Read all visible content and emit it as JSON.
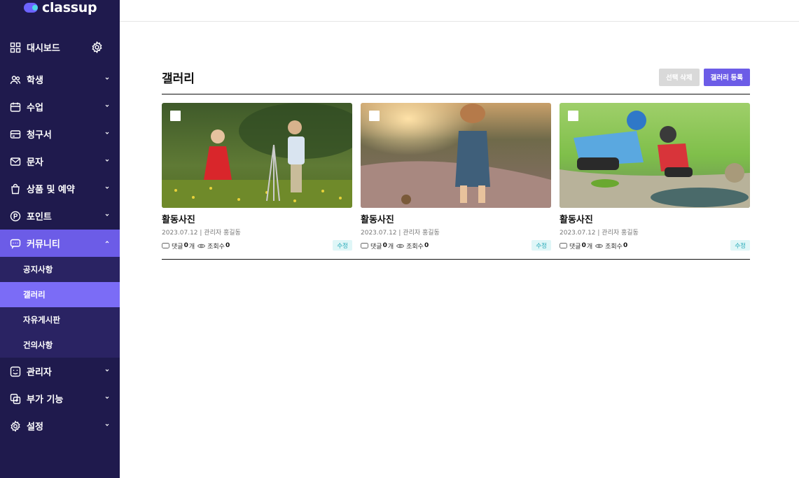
{
  "brand": {
    "name": "classup"
  },
  "sidebar": {
    "items": [
      {
        "label": "대시보드",
        "icon": "grid-icon"
      },
      {
        "label": "학생",
        "icon": "users-icon"
      },
      {
        "label": "수업",
        "icon": "calendar-icon"
      },
      {
        "label": "청구서",
        "icon": "card-icon"
      },
      {
        "label": "문자",
        "icon": "mail-icon"
      },
      {
        "label": "상품 및 예약",
        "icon": "bag-icon"
      },
      {
        "label": "포인트",
        "icon": "point-icon"
      },
      {
        "label": "커뮤니티",
        "icon": "chat-icon"
      },
      {
        "label": "관리자",
        "icon": "admin-icon"
      },
      {
        "label": "부가 기능",
        "icon": "addon-icon"
      },
      {
        "label": "설정",
        "icon": "gear-icon"
      }
    ],
    "community_sub": [
      "공지사항",
      "갤러리",
      "자유게시판",
      "건의사항"
    ]
  },
  "page": {
    "title": "갤러리",
    "delete_label": "선택 삭제",
    "register_label": "갤러리 등록"
  },
  "cards": [
    {
      "title": "활동사진",
      "meta": "2023.07.12 | 관리자 홍길동",
      "comments_label": "댓글",
      "comments": "0",
      "comments_unit": "개",
      "views_label": "조회수",
      "views": "0",
      "edit_label": "수정"
    },
    {
      "title": "활동사진",
      "meta": "2023.07.12 | 관리자 홍길동",
      "comments_label": "댓글",
      "comments": "0",
      "comments_unit": "개",
      "views_label": "조회수",
      "views": "0",
      "edit_label": "수정"
    },
    {
      "title": "활동사진",
      "meta": "2023.07.12 | 관리자 홍길동",
      "comments_label": "댓글",
      "comments": "0",
      "comments_unit": "개",
      "views_label": "조회수",
      "views": "0",
      "edit_label": "수정"
    }
  ],
  "colors": {
    "sidebar_bg": "#1f1a4d",
    "accent": "#6c5ce7",
    "sub_bg": "#2a2363",
    "edit_badge": "#25a9b8"
  }
}
